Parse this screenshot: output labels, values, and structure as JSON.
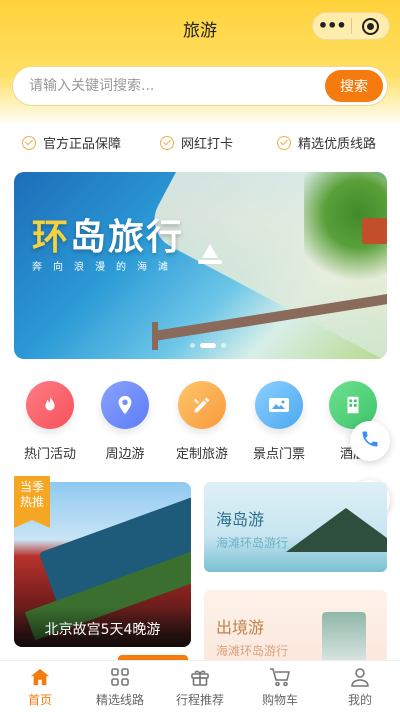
{
  "app": {
    "title": "旅游"
  },
  "search": {
    "placeholder": "请输入关键词搜索...",
    "button_label": "搜索"
  },
  "features": [
    "官方正品保障",
    "网红打卡",
    "精选优质线路"
  ],
  "banner": {
    "title_first": "环",
    "title_rest": "岛旅行",
    "subtitle": "奔向浪漫的海滩",
    "page_count": 3,
    "active_page": 1
  },
  "categories": [
    {
      "label": "热门活动",
      "icon": "fire-icon",
      "color": "#f5525b"
    },
    {
      "label": "周边游",
      "icon": "location-pin-icon",
      "color": "#5b7cf5"
    },
    {
      "label": "定制旅游",
      "icon": "pencil-ruler-icon",
      "color": "#f79a3b"
    },
    {
      "label": "景点门票",
      "icon": "ticket-icon",
      "color": "#4aa8f0"
    },
    {
      "label": "酒店",
      "icon": "hotel-icon",
      "color": "#3dc46b"
    }
  ],
  "float_buttons": [
    {
      "icon": "phone-icon",
      "color": "#3a8ef6"
    },
    {
      "icon": "wechat-icon",
      "color": "#2dba4e"
    }
  ],
  "promo": {
    "tag_line1": "当季",
    "tag_line2": "热推",
    "big_card_title": "北京故宫5天4晚游",
    "cards": [
      {
        "title": "海岛游",
        "subtitle": "海滩环岛游行"
      },
      {
        "title": "出境游",
        "subtitle": "海滩环岛游行"
      }
    ]
  },
  "tabbar": [
    {
      "label": "首页",
      "icon": "home-icon",
      "active": true
    },
    {
      "label": "精选线路",
      "icon": "grid-icon",
      "active": false
    },
    {
      "label": "行程推荐",
      "icon": "gift-icon",
      "active": false
    },
    {
      "label": "购物车",
      "icon": "cart-icon",
      "active": false
    },
    {
      "label": "我的",
      "icon": "user-icon",
      "active": false
    }
  ],
  "colors": {
    "accent": "#f57b0e",
    "header": "#ffd23a",
    "check": "#e8b24a"
  }
}
